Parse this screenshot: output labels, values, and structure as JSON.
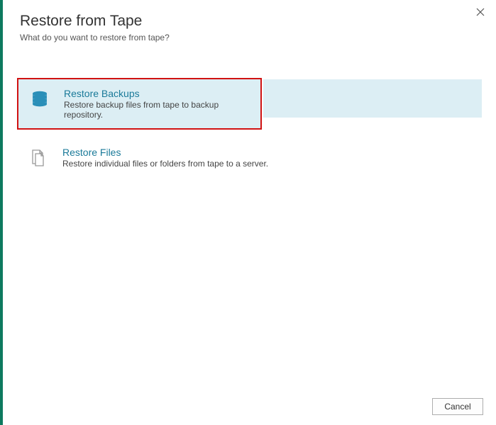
{
  "header": {
    "title": "Restore from Tape",
    "subtitle": "What do you want to restore from tape?"
  },
  "options": {
    "restore_backups": {
      "title": "Restore Backups",
      "description": "Restore backup files from tape to backup repository."
    },
    "restore_files": {
      "title": "Restore Files",
      "description": "Restore individual files or folders from tape to a server."
    }
  },
  "buttons": {
    "cancel": "Cancel"
  }
}
